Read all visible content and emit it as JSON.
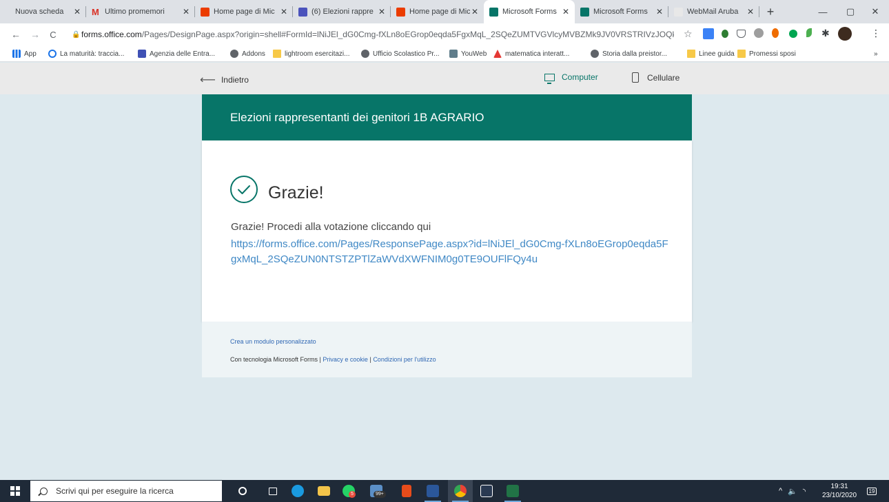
{
  "browser": {
    "tabs": [
      {
        "title": "Nuova scheda",
        "favicon_color": ""
      },
      {
        "title": "Ultimo promemori",
        "favicon_color": "#d93025",
        "icon": "gmail-icon"
      },
      {
        "title": "Home page di Mic",
        "favicon_color": "#eb3c00",
        "icon": "office-icon"
      },
      {
        "title": "(6) Elezioni rappre",
        "favicon_color": "#4b53bc",
        "icon": "teams-icon"
      },
      {
        "title": "Home page di Mic",
        "favicon_color": "#eb3c00",
        "icon": "office-icon"
      },
      {
        "title": "Microsoft Forms",
        "favicon_color": "#077568",
        "icon": "forms-icon",
        "active": true
      },
      {
        "title": "Microsoft Forms",
        "favicon_color": "#077568",
        "icon": "forms-icon"
      },
      {
        "title": "WebMail Aruba",
        "favicon_color": "#cccccc",
        "icon": "webmail-icon"
      }
    ],
    "new_tab": "+",
    "window": {
      "minimize": "—",
      "maximize": "▢",
      "close": "✕"
    },
    "url_host": "forms.office.com",
    "url_path": "/Pages/DesignPage.aspx?origin=shell#FormId=lNiJEl_dG0Cmg-fXLn8oEGrop0eqda5FgxMqL_2SQeZUMTVGVlcyMVBZMk9JV0VRSTRIVzJOQkc2MS4...",
    "nav": {
      "back": "←",
      "forward": "→",
      "reload": "C"
    },
    "bookmarks": [
      {
        "label": "App",
        "icon": "apps-grid-icon"
      },
      {
        "label": "La maturità: traccia...",
        "icon": "circle-icon"
      },
      {
        "label": "Agenzia delle Entra...",
        "icon": "agenzia-icon"
      },
      {
        "label": "Addons",
        "icon": "globe-icon"
      },
      {
        "label": "lightroom esercitazi...",
        "icon": "folder-icon"
      },
      {
        "label": "Ufficio Scolastico Pr...",
        "icon": "globe-icon"
      },
      {
        "label": "YouWeb",
        "icon": "youweb-icon"
      },
      {
        "label": "matematica interatt...",
        "icon": "adobe-icon"
      },
      {
        "label": "Storia dalla preistor...",
        "icon": "globe-icon"
      },
      {
        "label": "Linee guida",
        "icon": "folder-icon"
      },
      {
        "label": "Promessi sposi",
        "icon": "folder-icon"
      }
    ],
    "bookmarks_more": "»"
  },
  "forms": {
    "back_label": "Indietro",
    "view_computer": "Computer",
    "view_mobile": "Cellulare",
    "form_title": "Elezioni rappresentanti dei genitori 1B AGRARIO",
    "thanks_heading": "Grazie!",
    "thanks_message": "Grazie! Procedi alla votazione cliccando qui",
    "thanks_link": "https://forms.office.com/Pages/ResponsePage.aspx?id=lNiJEl_dG0Cmg-fXLn8oEGrop0eqda5FgxMqL_2SQeZUN0NTSTZPTlZaWVdXWFNIM0g0TE9OUFlFQy4u",
    "create_link": "Crea un modulo personalizzato",
    "powered_by": "Con tecnologia Microsoft Forms |",
    "privacy_link": "Privacy e cookie",
    "sep": "|",
    "terms_link": "Condizioni per l'utilizzo",
    "accent_color": "#077568"
  },
  "taskbar": {
    "search_placeholder": "Scrivi qui per eseguire la ricerca",
    "badge_mail": "99+",
    "badge_whatsapp": "5",
    "time": "19:31",
    "date": "23/10/2020",
    "notifications": "19"
  }
}
